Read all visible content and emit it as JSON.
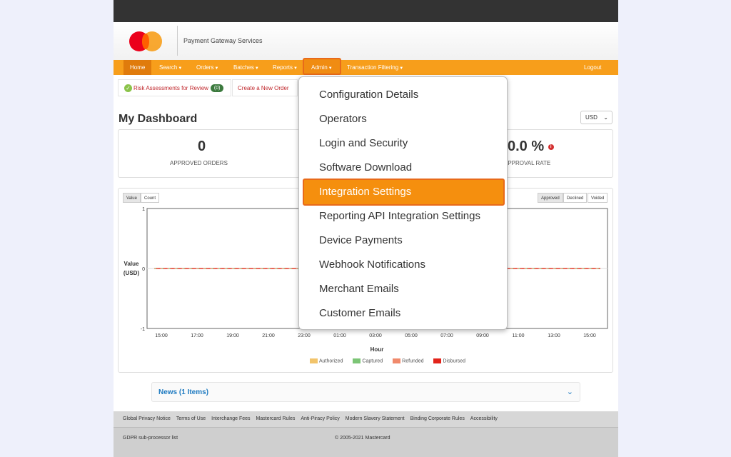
{
  "header": {
    "title": "Payment Gateway Services"
  },
  "nav": {
    "items": [
      "Home",
      "Search",
      "Orders",
      "Batches",
      "Reports",
      "Admin",
      "Transaction Filtering"
    ],
    "logout": "Logout"
  },
  "subtabs": {
    "risk_label": "Risk Assessments for Review",
    "risk_count": "(0)",
    "create_order": "Create a New Order"
  },
  "dashboard": {
    "title": "My Dashboard",
    "currency": "USD",
    "stats": [
      {
        "value": "0",
        "label": "APPROVED ORDERS"
      },
      {
        "value": "0.0 %",
        "label": "APPROVAL RATE"
      }
    ]
  },
  "chart_controls": {
    "metric": [
      "Value",
      "Count"
    ],
    "metric_selected": "Value",
    "status": [
      "Approved",
      "Declined",
      "Voided"
    ],
    "status_selected": "Approved"
  },
  "chart_data": {
    "type": "line",
    "title": "",
    "ylabel": "Value (USD)",
    "xlabel": "Hour",
    "ylim": [
      -1,
      1
    ],
    "yticks": [
      "1",
      "0",
      "-1"
    ],
    "x": [
      "15:00",
      "17:00",
      "19:00",
      "21:00",
      "23:00",
      "01:00",
      "03:00",
      "05:00",
      "07:00",
      "09:00",
      "11:00",
      "13:00",
      "15:00"
    ],
    "series": [
      {
        "name": "Authorized",
        "color": "#f2c46b",
        "values": [
          0,
          0,
          0,
          0,
          0,
          0,
          0,
          0,
          0,
          0,
          0,
          0,
          0
        ]
      },
      {
        "name": "Captured",
        "color": "#7cc576",
        "values": [
          0,
          0,
          0,
          0,
          0,
          0,
          0,
          0,
          0,
          0,
          0,
          0,
          0
        ]
      },
      {
        "name": "Refunded",
        "color": "#f08a6c",
        "values": [
          0,
          0,
          0,
          0,
          0,
          0,
          0,
          0,
          0,
          0,
          0,
          0,
          0
        ]
      },
      {
        "name": "Disbursed",
        "color": "#e2231a",
        "values": [
          0,
          0,
          0,
          0,
          0,
          0,
          0,
          0,
          0,
          0,
          0,
          0,
          0
        ]
      }
    ],
    "legend": "bottom",
    "grid": false
  },
  "news": {
    "title": "News (1 Items)"
  },
  "footer": {
    "links": [
      "Global Privacy Notice",
      "Terms of Use",
      "Interchange Fees",
      "Mastercard Rules",
      "Anti-Piracy Policy",
      "Modern Slavery Statement",
      "Binding Corporate Rules",
      "Accessibility"
    ],
    "subprocessor": "GDPR sub-processor list",
    "copyright": "© 2005-2021 Mastercard"
  },
  "admin_menu": {
    "items": [
      "Configuration Details",
      "Operators",
      "Login and Security",
      "Software Download",
      "Integration Settings",
      "Reporting API Integration Settings",
      "Device Payments",
      "Webhook Notifications",
      "Merchant Emails",
      "Customer Emails"
    ],
    "highlighted": "Integration Settings"
  },
  "colors": {
    "brand_orange": "#f79e1b",
    "highlight_orange": "#f58f0e",
    "highlight_border": "#e86a1a",
    "mastercard_red": "#eb001b"
  }
}
